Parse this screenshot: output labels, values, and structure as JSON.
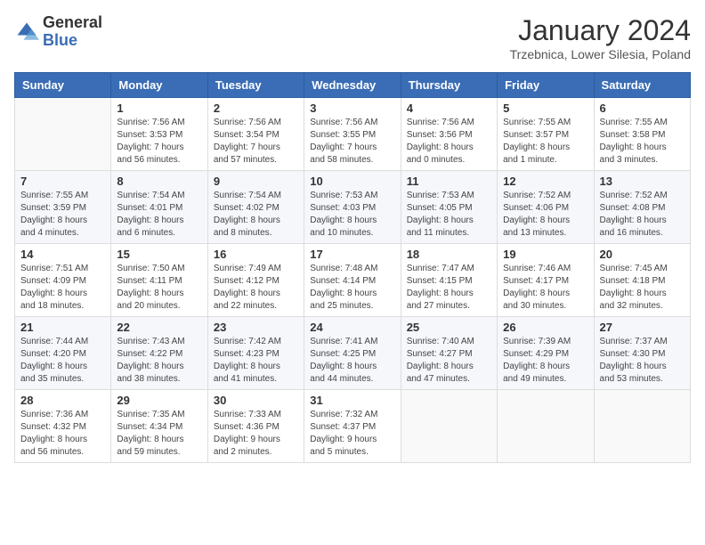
{
  "logo": {
    "general": "General",
    "blue": "Blue"
  },
  "header": {
    "month": "January 2024",
    "location": "Trzebnica, Lower Silesia, Poland"
  },
  "days_of_week": [
    "Sunday",
    "Monday",
    "Tuesday",
    "Wednesday",
    "Thursday",
    "Friday",
    "Saturday"
  ],
  "weeks": [
    [
      {
        "day": "",
        "info": ""
      },
      {
        "day": "1",
        "info": "Sunrise: 7:56 AM\nSunset: 3:53 PM\nDaylight: 7 hours\nand 56 minutes."
      },
      {
        "day": "2",
        "info": "Sunrise: 7:56 AM\nSunset: 3:54 PM\nDaylight: 7 hours\nand 57 minutes."
      },
      {
        "day": "3",
        "info": "Sunrise: 7:56 AM\nSunset: 3:55 PM\nDaylight: 7 hours\nand 58 minutes."
      },
      {
        "day": "4",
        "info": "Sunrise: 7:56 AM\nSunset: 3:56 PM\nDaylight: 8 hours\nand 0 minutes."
      },
      {
        "day": "5",
        "info": "Sunrise: 7:55 AM\nSunset: 3:57 PM\nDaylight: 8 hours\nand 1 minute."
      },
      {
        "day": "6",
        "info": "Sunrise: 7:55 AM\nSunset: 3:58 PM\nDaylight: 8 hours\nand 3 minutes."
      }
    ],
    [
      {
        "day": "7",
        "info": "Sunrise: 7:55 AM\nSunset: 3:59 PM\nDaylight: 8 hours\nand 4 minutes."
      },
      {
        "day": "8",
        "info": "Sunrise: 7:54 AM\nSunset: 4:01 PM\nDaylight: 8 hours\nand 6 minutes."
      },
      {
        "day": "9",
        "info": "Sunrise: 7:54 AM\nSunset: 4:02 PM\nDaylight: 8 hours\nand 8 minutes."
      },
      {
        "day": "10",
        "info": "Sunrise: 7:53 AM\nSunset: 4:03 PM\nDaylight: 8 hours\nand 10 minutes."
      },
      {
        "day": "11",
        "info": "Sunrise: 7:53 AM\nSunset: 4:05 PM\nDaylight: 8 hours\nand 11 minutes."
      },
      {
        "day": "12",
        "info": "Sunrise: 7:52 AM\nSunset: 4:06 PM\nDaylight: 8 hours\nand 13 minutes."
      },
      {
        "day": "13",
        "info": "Sunrise: 7:52 AM\nSunset: 4:08 PM\nDaylight: 8 hours\nand 16 minutes."
      }
    ],
    [
      {
        "day": "14",
        "info": "Sunrise: 7:51 AM\nSunset: 4:09 PM\nDaylight: 8 hours\nand 18 minutes."
      },
      {
        "day": "15",
        "info": "Sunrise: 7:50 AM\nSunset: 4:11 PM\nDaylight: 8 hours\nand 20 minutes."
      },
      {
        "day": "16",
        "info": "Sunrise: 7:49 AM\nSunset: 4:12 PM\nDaylight: 8 hours\nand 22 minutes."
      },
      {
        "day": "17",
        "info": "Sunrise: 7:48 AM\nSunset: 4:14 PM\nDaylight: 8 hours\nand 25 minutes."
      },
      {
        "day": "18",
        "info": "Sunrise: 7:47 AM\nSunset: 4:15 PM\nDaylight: 8 hours\nand 27 minutes."
      },
      {
        "day": "19",
        "info": "Sunrise: 7:46 AM\nSunset: 4:17 PM\nDaylight: 8 hours\nand 30 minutes."
      },
      {
        "day": "20",
        "info": "Sunrise: 7:45 AM\nSunset: 4:18 PM\nDaylight: 8 hours\nand 32 minutes."
      }
    ],
    [
      {
        "day": "21",
        "info": "Sunrise: 7:44 AM\nSunset: 4:20 PM\nDaylight: 8 hours\nand 35 minutes."
      },
      {
        "day": "22",
        "info": "Sunrise: 7:43 AM\nSunset: 4:22 PM\nDaylight: 8 hours\nand 38 minutes."
      },
      {
        "day": "23",
        "info": "Sunrise: 7:42 AM\nSunset: 4:23 PM\nDaylight: 8 hours\nand 41 minutes."
      },
      {
        "day": "24",
        "info": "Sunrise: 7:41 AM\nSunset: 4:25 PM\nDaylight: 8 hours\nand 44 minutes."
      },
      {
        "day": "25",
        "info": "Sunrise: 7:40 AM\nSunset: 4:27 PM\nDaylight: 8 hours\nand 47 minutes."
      },
      {
        "day": "26",
        "info": "Sunrise: 7:39 AM\nSunset: 4:29 PM\nDaylight: 8 hours\nand 49 minutes."
      },
      {
        "day": "27",
        "info": "Sunrise: 7:37 AM\nSunset: 4:30 PM\nDaylight: 8 hours\nand 53 minutes."
      }
    ],
    [
      {
        "day": "28",
        "info": "Sunrise: 7:36 AM\nSunset: 4:32 PM\nDaylight: 8 hours\nand 56 minutes."
      },
      {
        "day": "29",
        "info": "Sunrise: 7:35 AM\nSunset: 4:34 PM\nDaylight: 8 hours\nand 59 minutes."
      },
      {
        "day": "30",
        "info": "Sunrise: 7:33 AM\nSunset: 4:36 PM\nDaylight: 9 hours\nand 2 minutes."
      },
      {
        "day": "31",
        "info": "Sunrise: 7:32 AM\nSunset: 4:37 PM\nDaylight: 9 hours\nand 5 minutes."
      },
      {
        "day": "",
        "info": ""
      },
      {
        "day": "",
        "info": ""
      },
      {
        "day": "",
        "info": ""
      }
    ]
  ]
}
